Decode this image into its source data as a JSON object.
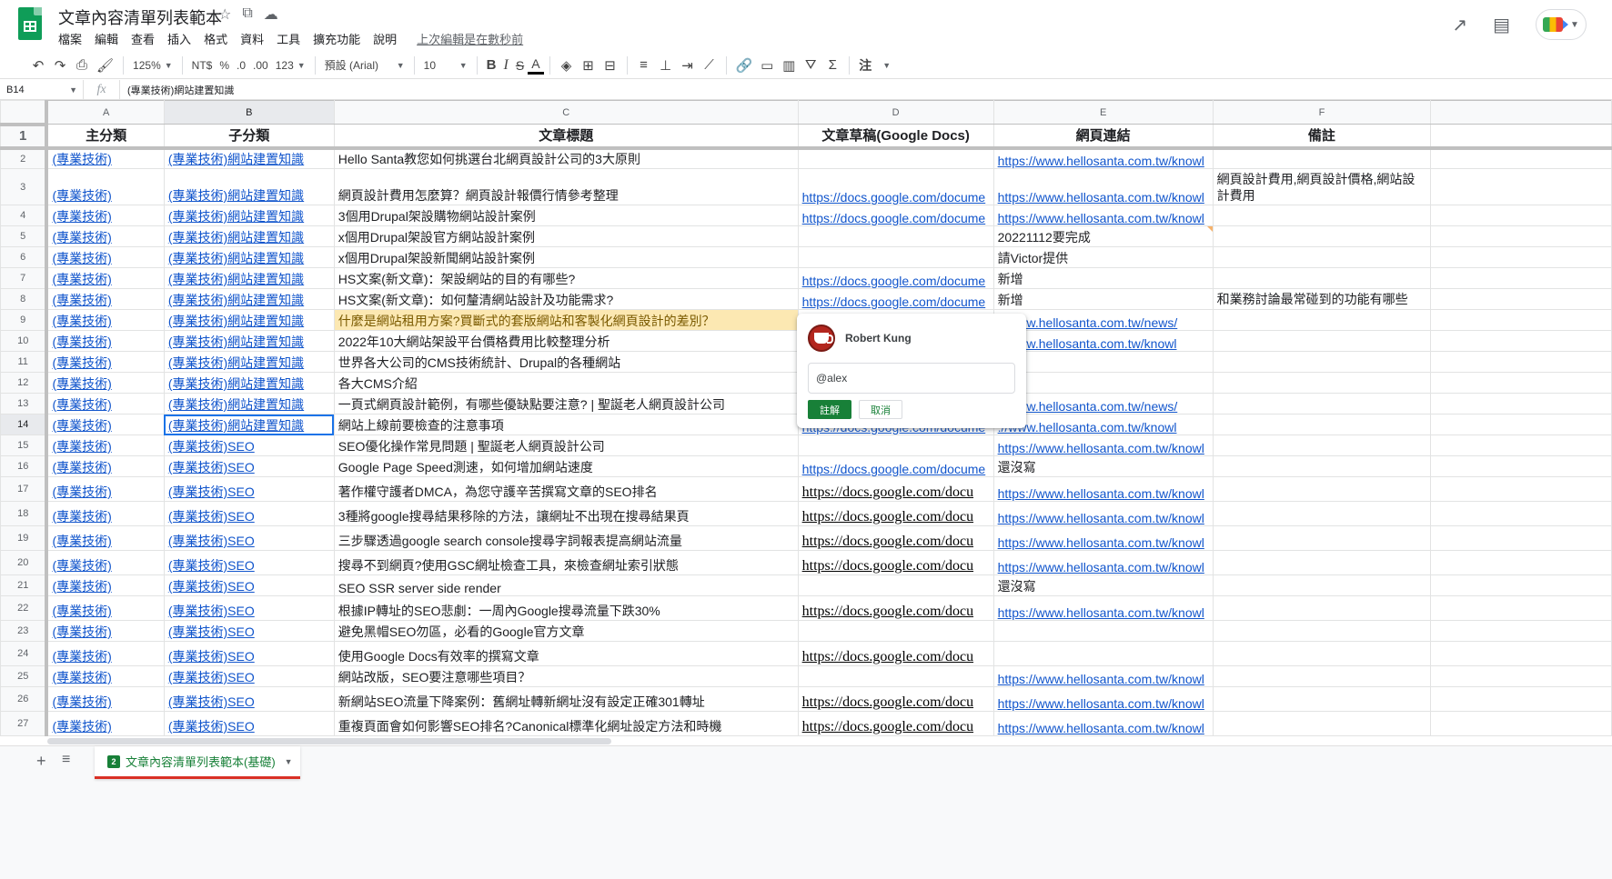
{
  "app": {
    "title": "文章內容清單列表範本",
    "menu": [
      "檔案",
      "編輯",
      "查看",
      "插入",
      "格式",
      "資料",
      "工具",
      "擴充功能",
      "說明"
    ],
    "last_edit": "上次編輯是在數秒前",
    "icons": {
      "star": "star-icon",
      "move": "folder-move-icon",
      "cloud": "cloud-status-icon",
      "trend": "trending-up-icon",
      "comments": "comment-history-icon",
      "meet": "meet-icon"
    }
  },
  "toolbar": {
    "zoom": "125%",
    "currency": "NT$",
    "percent": "%",
    "dec_decrease": ".0",
    "dec_increase": ".00",
    "more_formats": "123",
    "font": "預設 (Arial)",
    "font_size": "10",
    "bold": "B",
    "italic": "I",
    "strike": "S",
    "text_color": "A",
    "note_label": "注"
  },
  "formula_bar": {
    "cell_ref": "B14",
    "fx": "fx",
    "content": "(專業技術)網站建置知識"
  },
  "columns": [
    "A",
    "B",
    "C",
    "D",
    "E",
    "F"
  ],
  "header_row": [
    "主分類",
    "子分類",
    "文章標題",
    "文章草稿(Google Docs)",
    "網頁連結",
    "備註"
  ],
  "rows": [
    {
      "n": "2",
      "a": "(專業技術)",
      "b": "(專業技術)網站建置知識",
      "c": "Hello Santa教您如何挑選台北網頁設計公司的3大原則",
      "d": "",
      "e": "https://www.hellosanta.com.tw/knowl",
      "f": ""
    },
    {
      "n": "3",
      "a": "(專業技術)",
      "b": "(專業技術)網站建置知識",
      "c": "網頁設計費用怎麼算？網頁設計報價行情參考整理",
      "d": "https://docs.google.com/docume",
      "e": "https://www.hellosanta.com.tw/knowl",
      "f": "網頁設計費用,網頁設計價格,網站設計費用"
    },
    {
      "n": "4",
      "a": "(專業技術)",
      "b": "(專業技術)網站建置知識",
      "c": "3個用Drupal架設購物網站設計案例",
      "d": "https://docs.google.com/docume",
      "e": "https://www.hellosanta.com.tw/knowl",
      "f": ""
    },
    {
      "n": "5",
      "a": "(專業技術)",
      "b": "(專業技術)網站建置知識",
      "c": "x個用Drupal架設官方網站設計案例",
      "d": "",
      "e": "20221112要完成",
      "f": ""
    },
    {
      "n": "6",
      "a": "(專業技術)",
      "b": "(專業技術)網站建置知識",
      "c": "x個用Drupal架設新聞網站設計案例",
      "d": "",
      "e": "請Victor提供",
      "f": ""
    },
    {
      "n": "7",
      "a": "(專業技術)",
      "b": "(專業技術)網站建置知識",
      "c": "HS文案(新文章)：架設網站的目的有哪些?",
      "d": "https://docs.google.com/docume",
      "e": "新增",
      "f": ""
    },
    {
      "n": "8",
      "a": "(專業技術)",
      "b": "(專業技術)網站建置知識",
      "c": "HS文案(新文章)：如何釐清網站設計及功能需求?",
      "d": "https://docs.google.com/docume",
      "e": "新增",
      "f": "和業務討論最常碰到的功能有哪些"
    },
    {
      "n": "9",
      "a": "(專業技術)",
      "b": "(專業技術)網站建置知識",
      "c": "什麼是網站租用方案?買斷式的套版網站和客製化網頁設計的差別？",
      "d": "",
      "e": "://www.hellosanta.com.tw/news/",
      "f": ""
    },
    {
      "n": "10",
      "a": "(專業技術)",
      "b": "(專業技術)網站建置知識",
      "c": "2022年10大網站架設平台價格費用比較整理分析",
      "d": "",
      "e": "://www.hellosanta.com.tw/knowl",
      "f": ""
    },
    {
      "n": "11",
      "a": "(專業技術)",
      "b": "(專業技術)網站建置知識",
      "c": "世界各大公司的CMS技術統計、Drupal的各種網站",
      "d": "",
      "e": "",
      "f": ""
    },
    {
      "n": "12",
      "a": "(專業技術)",
      "b": "(專業技術)網站建置知識",
      "c": "各大CMS介紹",
      "d": "",
      "e": "",
      "f": ""
    },
    {
      "n": "13",
      "a": "(專業技術)",
      "b": "(專業技術)網站建置知識",
      "c": "一頁式網頁設計範例，有哪些優缺點要注意? | 聖誕老人網頁設計公司",
      "d": "",
      "e": "://www.hellosanta.com.tw/news/",
      "f": ""
    },
    {
      "n": "14",
      "a": "(專業技術)",
      "b": "(專業技術)網站建置知識",
      "c": "網站上線前要檢查的注意事項",
      "d": "https://docs.google.com/docume",
      "e": "://www.hellosanta.com.tw/knowl",
      "f": ""
    },
    {
      "n": "15",
      "a": "(專業技術)",
      "b": "(專業技術)SEO",
      "c": "SEO優化操作常見問題 | 聖誕老人網頁設計公司",
      "d": "",
      "e": "https://www.hellosanta.com.tw/knowl",
      "f": ""
    },
    {
      "n": "16",
      "a": "(專業技術)",
      "b": "(專業技術)SEO",
      "c": "Google Page Speed測速，如何增加網站速度",
      "d": "https://docs.google.com/docume",
      "e": "還沒寫",
      "f": ""
    },
    {
      "n": "17",
      "a": "(專業技術)",
      "b": "(專業技術)SEO",
      "c": "著作權守護者DMCA，為您守護辛苦撰寫文章的SEO排名",
      "d": "https://docs.google.com/docu",
      "e": "https://www.hellosanta.com.tw/knowl",
      "f": ""
    },
    {
      "n": "18",
      "a": "(專業技術)",
      "b": "(專業技術)SEO",
      "c": "3種將google搜尋結果移除的方法，讓網址不出現在搜尋結果頁",
      "d": "https://docs.google.com/docu",
      "e": "https://www.hellosanta.com.tw/knowl",
      "f": ""
    },
    {
      "n": "19",
      "a": "(專業技術)",
      "b": "(專業技術)SEO",
      "c": "三步驟透過google search console搜尋字詞報表提高網站流量",
      "d": "https://docs.google.com/docu",
      "e": "https://www.hellosanta.com.tw/knowl",
      "f": ""
    },
    {
      "n": "20",
      "a": "(專業技術)",
      "b": "(專業技術)SEO",
      "c": "搜尋不到網頁?使用GSC網址檢查工具，來檢查網址索引狀態",
      "d": "https://docs.google.com/docu",
      "e": "https://www.hellosanta.com.tw/knowl",
      "f": ""
    },
    {
      "n": "21",
      "a": "(專業技術)",
      "b": "(專業技術)SEO",
      "c": "SEO SSR server side render",
      "d": "",
      "e": "還沒寫",
      "f": ""
    },
    {
      "n": "22",
      "a": "(專業技術)",
      "b": "(專業技術)SEO",
      "c": "根據IP轉址的SEO悲劇：一周內Google搜尋流量下跌30%",
      "d": "https://docs.google.com/docu",
      "e": "https://www.hellosanta.com.tw/knowl",
      "f": ""
    },
    {
      "n": "23",
      "a": "(專業技術)",
      "b": "(專業技術)SEO",
      "c": "避免黑帽SEO勿區，必看的Google官方文章",
      "d": "",
      "e": "",
      "f": ""
    },
    {
      "n": "24",
      "a": "(專業技術)",
      "b": "(專業技術)SEO",
      "c": "使用Google Docs有效率的撰寫文章",
      "d": "https://docs.google.com/docu",
      "e": "",
      "f": ""
    },
    {
      "n": "25",
      "a": "(專業技術)",
      "b": "(專業技術)SEO",
      "c": "網站改版，SEO要注意哪些項目？",
      "d": "",
      "e": "https://www.hellosanta.com.tw/knowl",
      "f": ""
    },
    {
      "n": "26",
      "a": "(專業技術)",
      "b": "(專業技術)SEO",
      "c": "新網站SEO流量下降案例：舊網址轉新網址沒有設定正確301轉址",
      "d": "https://docs.google.com/docu",
      "e": "https://www.hellosanta.com.tw/knowl",
      "f": ""
    },
    {
      "n": "27",
      "a": "(專業技術)",
      "b": "(專業技術)SEO",
      "c": "重複頁面會如何影響SEO排名?Canonical標準化網址設定方法和時機",
      "d": "https://docs.google.com/docu",
      "e": "https://www.hellosanta.com.tw/knowl",
      "f": ""
    }
  ],
  "comment": {
    "author": "Robert Kung",
    "input_value": "@alex",
    "comment_button": "註解",
    "cancel_button": "取消"
  },
  "sheet_tabs": {
    "active": "文章內容清單列表範本(基礎)",
    "icon_label": "2"
  },
  "colors": {
    "link": "#1155cc",
    "accent_green": "#188038",
    "highlight": "#fce8b2",
    "selection": "#1a73e8",
    "tab_underline": "#d93025"
  }
}
